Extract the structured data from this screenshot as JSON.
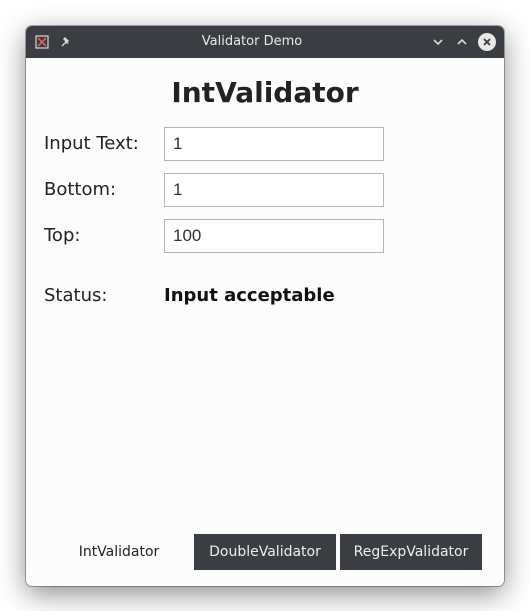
{
  "window": {
    "title": "Validator Demo"
  },
  "page": {
    "heading": "IntValidator"
  },
  "form": {
    "input_text": {
      "label": "Input Text:",
      "value": "1"
    },
    "bottom": {
      "label": "Bottom:",
      "value": "1"
    },
    "top": {
      "label": "Top:",
      "value": "100"
    }
  },
  "status": {
    "label": "Status:",
    "value": "Input acceptable"
  },
  "tabs": [
    {
      "label": "IntValidator",
      "active": true
    },
    {
      "label": "DoubleValidator",
      "active": false
    },
    {
      "label": "RegExpValidator",
      "active": false
    }
  ]
}
